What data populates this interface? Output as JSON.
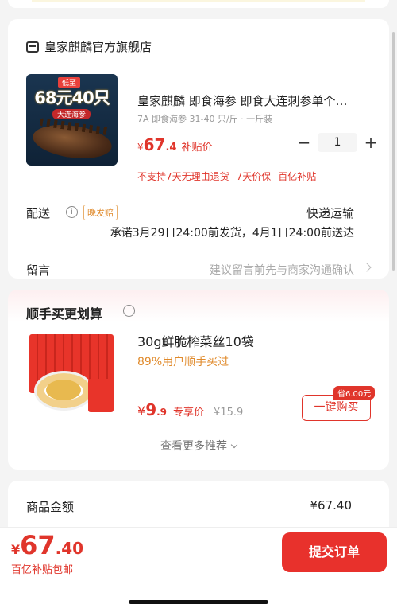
{
  "store": {
    "name": "皇家麒麟官方旗舰店",
    "product": {
      "image_badge_top": "低至",
      "image_badge_main": "68元40只",
      "image_badge_sub": "大连海参",
      "title": "皇家麒麟 即食海参 即食大连刺参单个…",
      "spec": "7A 即食海参 31-40 只/斤 · 一斤装",
      "price_yen": "¥",
      "price_int": "67",
      "price_dec": ".4",
      "price_tag": "补贴价",
      "quantity": "1",
      "minus": "−",
      "plus": "+"
    },
    "promos": [
      "不支持7天无理由退货",
      "7天价保",
      "百亿补贴"
    ],
    "shipping": {
      "label": "配送",
      "info_icon": "ⓘ",
      "late_tag": "晚发赔",
      "method": "快递运输",
      "promise": "承诺3月29日24:00前发货，4月1日24:00前送达"
    },
    "message": {
      "label": "留言",
      "hint": "建议留言前先与商家沟通确认"
    }
  },
  "recommend": {
    "title": "顺手买更划算",
    "info_icon": "ⓘ",
    "item": {
      "name": "30g鲜脆榨菜丝10袋",
      "percent": "89%用户顺手买过",
      "price_yen": "¥",
      "price_int": "9",
      "price_dec": ".9",
      "price_tag": "专享价",
      "original_price": "¥15.9",
      "save_tag": "省6.00元",
      "buy_label": "一键购买"
    },
    "more_label": "查看更多推荐"
  },
  "summary": {
    "label": "商品金额",
    "value": "¥67.40"
  },
  "bottom": {
    "total_yen": "¥",
    "total_int": "67",
    "total_dec": ".40",
    "note": "百亿补贴包邮",
    "submit_label": "提交订单"
  },
  "colors": {
    "accent": "#e0352b",
    "submit_bg": "#e8312c",
    "orange": "#e08a2b"
  }
}
